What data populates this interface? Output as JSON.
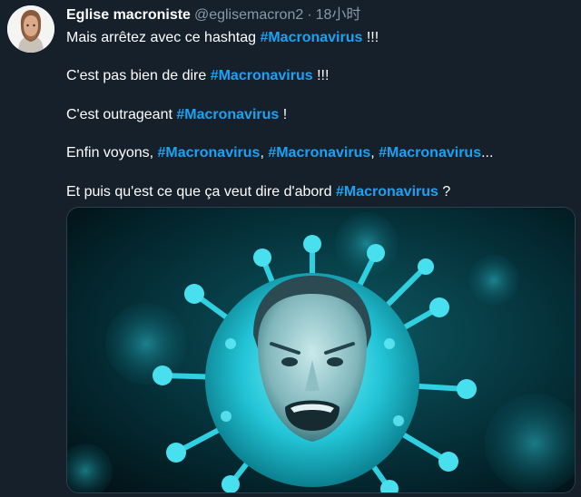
{
  "tweet": {
    "author_name": "Eglise macroniste",
    "author_handle": "@eglisemacron2",
    "separator": "·",
    "time": "18小时",
    "lines": [
      {
        "before": "Mais arrêtez avec ce hashtag ",
        "tags": [
          "#Macronavirus"
        ],
        "after": "  !!!"
      },
      {
        "before": "C'est pas bien de dire ",
        "tags": [
          "#Macronavirus"
        ],
        "after": " !!!"
      },
      {
        "before": "C'est outrageant ",
        "tags": [
          "#Macronavirus"
        ],
        "after": " !"
      },
      {
        "before": "Enfin voyons, ",
        "tags": [
          "#Macronavirus",
          "#Macronavirus",
          "#Macronavirus"
        ],
        "after": "..."
      },
      {
        "before": "Et puis qu'est ce que ça veut dire d'abord ",
        "tags": [
          "#Macronavirus"
        ],
        "after": " ?"
      }
    ],
    "media_icon": "coronavirus-face-image"
  },
  "colors": {
    "background": "#15202b",
    "hashtag": "#1da1f2",
    "muted": "#8899a6",
    "virus": "#1fc6d6"
  }
}
